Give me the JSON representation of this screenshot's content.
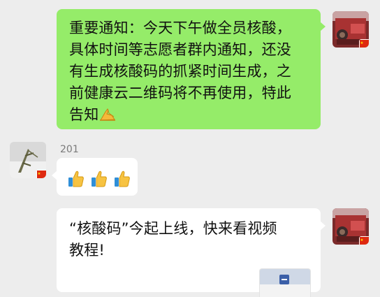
{
  "messages": {
    "m1": {
      "sender": "self",
      "line1": "重要通知：今天下午做全员核酸，",
      "line2": "具体时间等志愿者群内通知，还没",
      "line3": "有生成核酸码的抓紧时间生成，之",
      "line4": "前健康云二维码将不再使用，特此",
      "line5": "告知",
      "trailing_emoji": "praying-hands-icon"
    },
    "m2": {
      "sender_name": "201",
      "emoji": [
        "thumbs-up-icon",
        "thumbs-up-icon",
        "thumbs-up-icon"
      ]
    },
    "m3": {
      "sender": "self",
      "line1": "“核酸码”今起上线，快来看视频",
      "line2": "教程!"
    }
  },
  "colors": {
    "chat_background": "#ededed",
    "self_bubble": "#95ec69",
    "other_bubble": "#ffffff",
    "name_text": "#7a7a7a"
  }
}
